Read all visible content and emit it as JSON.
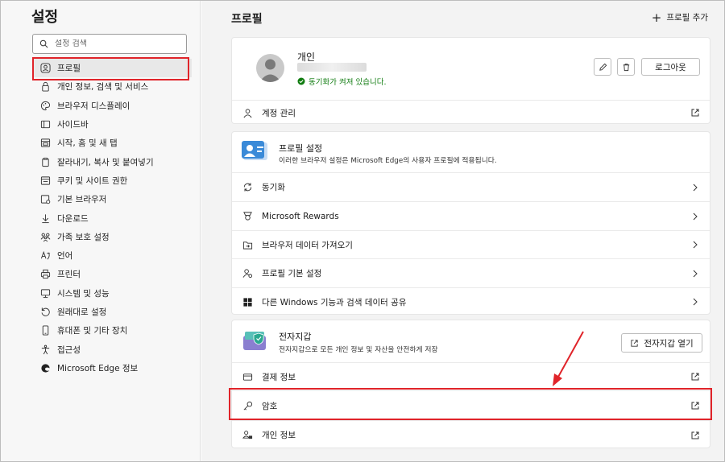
{
  "sidebar": {
    "title": "설정",
    "search_placeholder": "설정 검색",
    "items": [
      {
        "label": "프로필",
        "icon": "profile-icon"
      },
      {
        "label": "개인 정보, 검색 및 서비스",
        "icon": "lock-icon"
      },
      {
        "label": "브라우저 디스플레이",
        "icon": "palette-icon"
      },
      {
        "label": "사이드바",
        "icon": "sidebar-icon"
      },
      {
        "label": "시작, 홈 및 새 탭",
        "icon": "home-tab-icon"
      },
      {
        "label": "잘라내기, 복사 및 붙여넣기",
        "icon": "clipboard-icon"
      },
      {
        "label": "쿠키 및 사이트 권한",
        "icon": "cookie-icon"
      },
      {
        "label": "기본 브라우저",
        "icon": "browser-icon"
      },
      {
        "label": "다운로드",
        "icon": "download-icon"
      },
      {
        "label": "가족 보호 설정",
        "icon": "family-icon"
      },
      {
        "label": "언어",
        "icon": "language-icon"
      },
      {
        "label": "프린터",
        "icon": "printer-icon"
      },
      {
        "label": "시스템 및 성능",
        "icon": "system-icon"
      },
      {
        "label": "원래대로 설정",
        "icon": "reset-icon"
      },
      {
        "label": "휴대폰 및 기타 장치",
        "icon": "phone-icon"
      },
      {
        "label": "접근성",
        "icon": "accessibility-icon"
      },
      {
        "label": "Microsoft Edge 정보",
        "icon": "edge-icon"
      }
    ]
  },
  "main": {
    "title": "프로필",
    "add_profile": "프로필 추가",
    "profile": {
      "name": "개인",
      "sync_status": "동기화가 켜져 있습니다.",
      "logout": "로그아웃",
      "account": "계정 관리"
    },
    "settings_card": {
      "title": "프로필 설정",
      "desc": "이러한 브라우저 설정은 Microsoft Edge의 사용자 프로필에 적용됩니다.",
      "rows": [
        "동기화",
        "Microsoft Rewards",
        "브라우저 데이터 가져오기",
        "프로필 기본 설정",
        "다른 Windows 기능과 검색 데이터 공유"
      ]
    },
    "wallet": {
      "title": "전자지갑",
      "desc": "전자지갑으로 모든 개인 정보 및 자산을 안전하게 저장",
      "open_button": "전자지갑 열기",
      "rows": [
        "결제 정보",
        "암호",
        "개인 정보"
      ]
    }
  },
  "colors": {
    "highlight": "#e0242a",
    "sync_green": "#107c10"
  }
}
